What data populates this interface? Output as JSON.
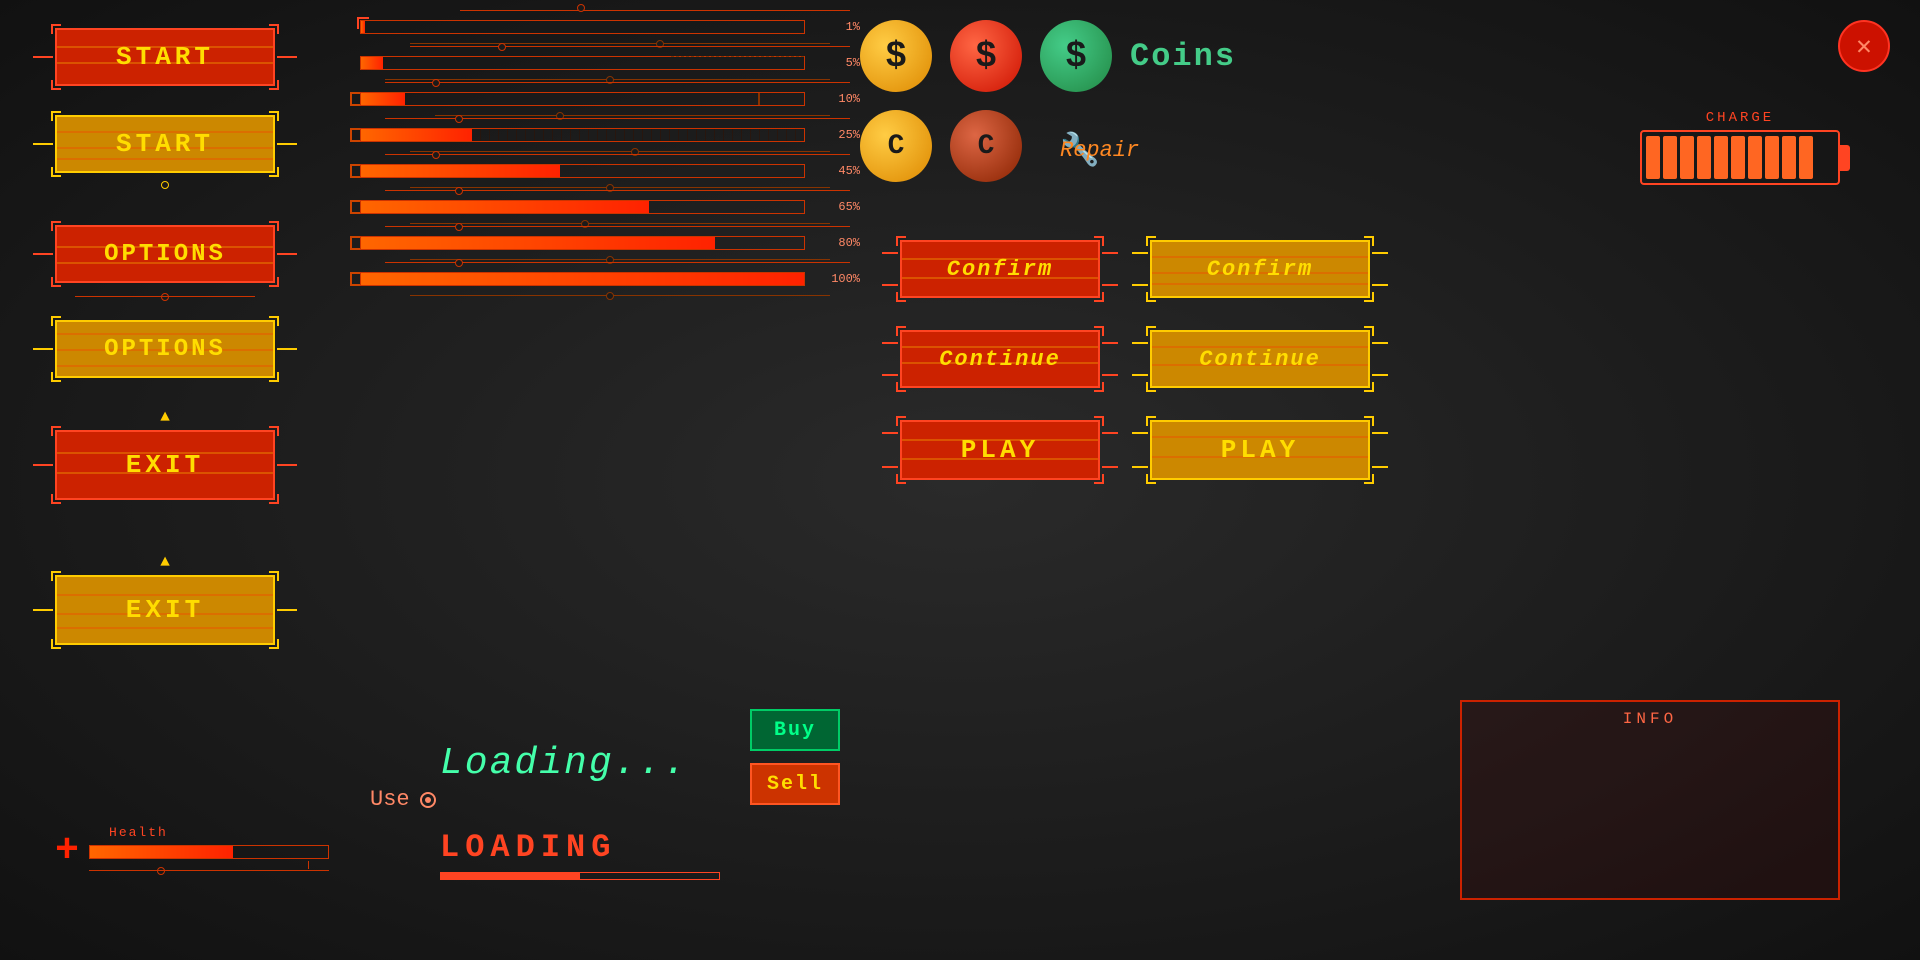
{
  "buttons_left": {
    "start_red_label": "START",
    "start_yellow_label": "START",
    "options_red_label": "OPTIONS",
    "options_yellow_label": "OPTIONS",
    "exit_red_label": "EXIT",
    "exit_yellow_label": "EXIT"
  },
  "progress_bars": [
    {
      "pct": 1,
      "label": "1%",
      "fill_pct": 1
    },
    {
      "pct": 5,
      "label": "5%",
      "fill_pct": 5
    },
    {
      "pct": 10,
      "label": "10%",
      "fill_pct": 10
    },
    {
      "pct": 25,
      "label": "25%",
      "fill_pct": 25
    },
    {
      "pct": 45,
      "label": "45%",
      "fill_pct": 45
    },
    {
      "pct": 65,
      "label": "65%",
      "fill_pct": 65
    },
    {
      "pct": 80,
      "label": "80%",
      "fill_pct": 80
    },
    {
      "pct": 100,
      "label": "100%",
      "fill_pct": 100
    }
  ],
  "coins": {
    "coin1_symbol": "$",
    "coin2_symbol": "$",
    "coin3_symbol": "$",
    "coin4_symbol": "C",
    "coin5_symbol": "C",
    "label": "Coins"
  },
  "repair": {
    "label": "Repair"
  },
  "charge": {
    "label": "CHARGE"
  },
  "action_buttons_center": {
    "confirm_red": "Confirm",
    "continue_red": "Continue",
    "play_red": "PLAY",
    "confirm_yellow": "Confirm",
    "continue_yellow": "Continue",
    "play_yellow": "PLAY"
  },
  "loading": {
    "animated_text": "Loading...",
    "static_text": "LOADING"
  },
  "use": {
    "label": "Use"
  },
  "buy": {
    "label": "Buy"
  },
  "sell": {
    "label": "Sell"
  },
  "health": {
    "label": "Health"
  },
  "info": {
    "title": "INFO"
  },
  "close": {
    "symbol": "✕"
  }
}
